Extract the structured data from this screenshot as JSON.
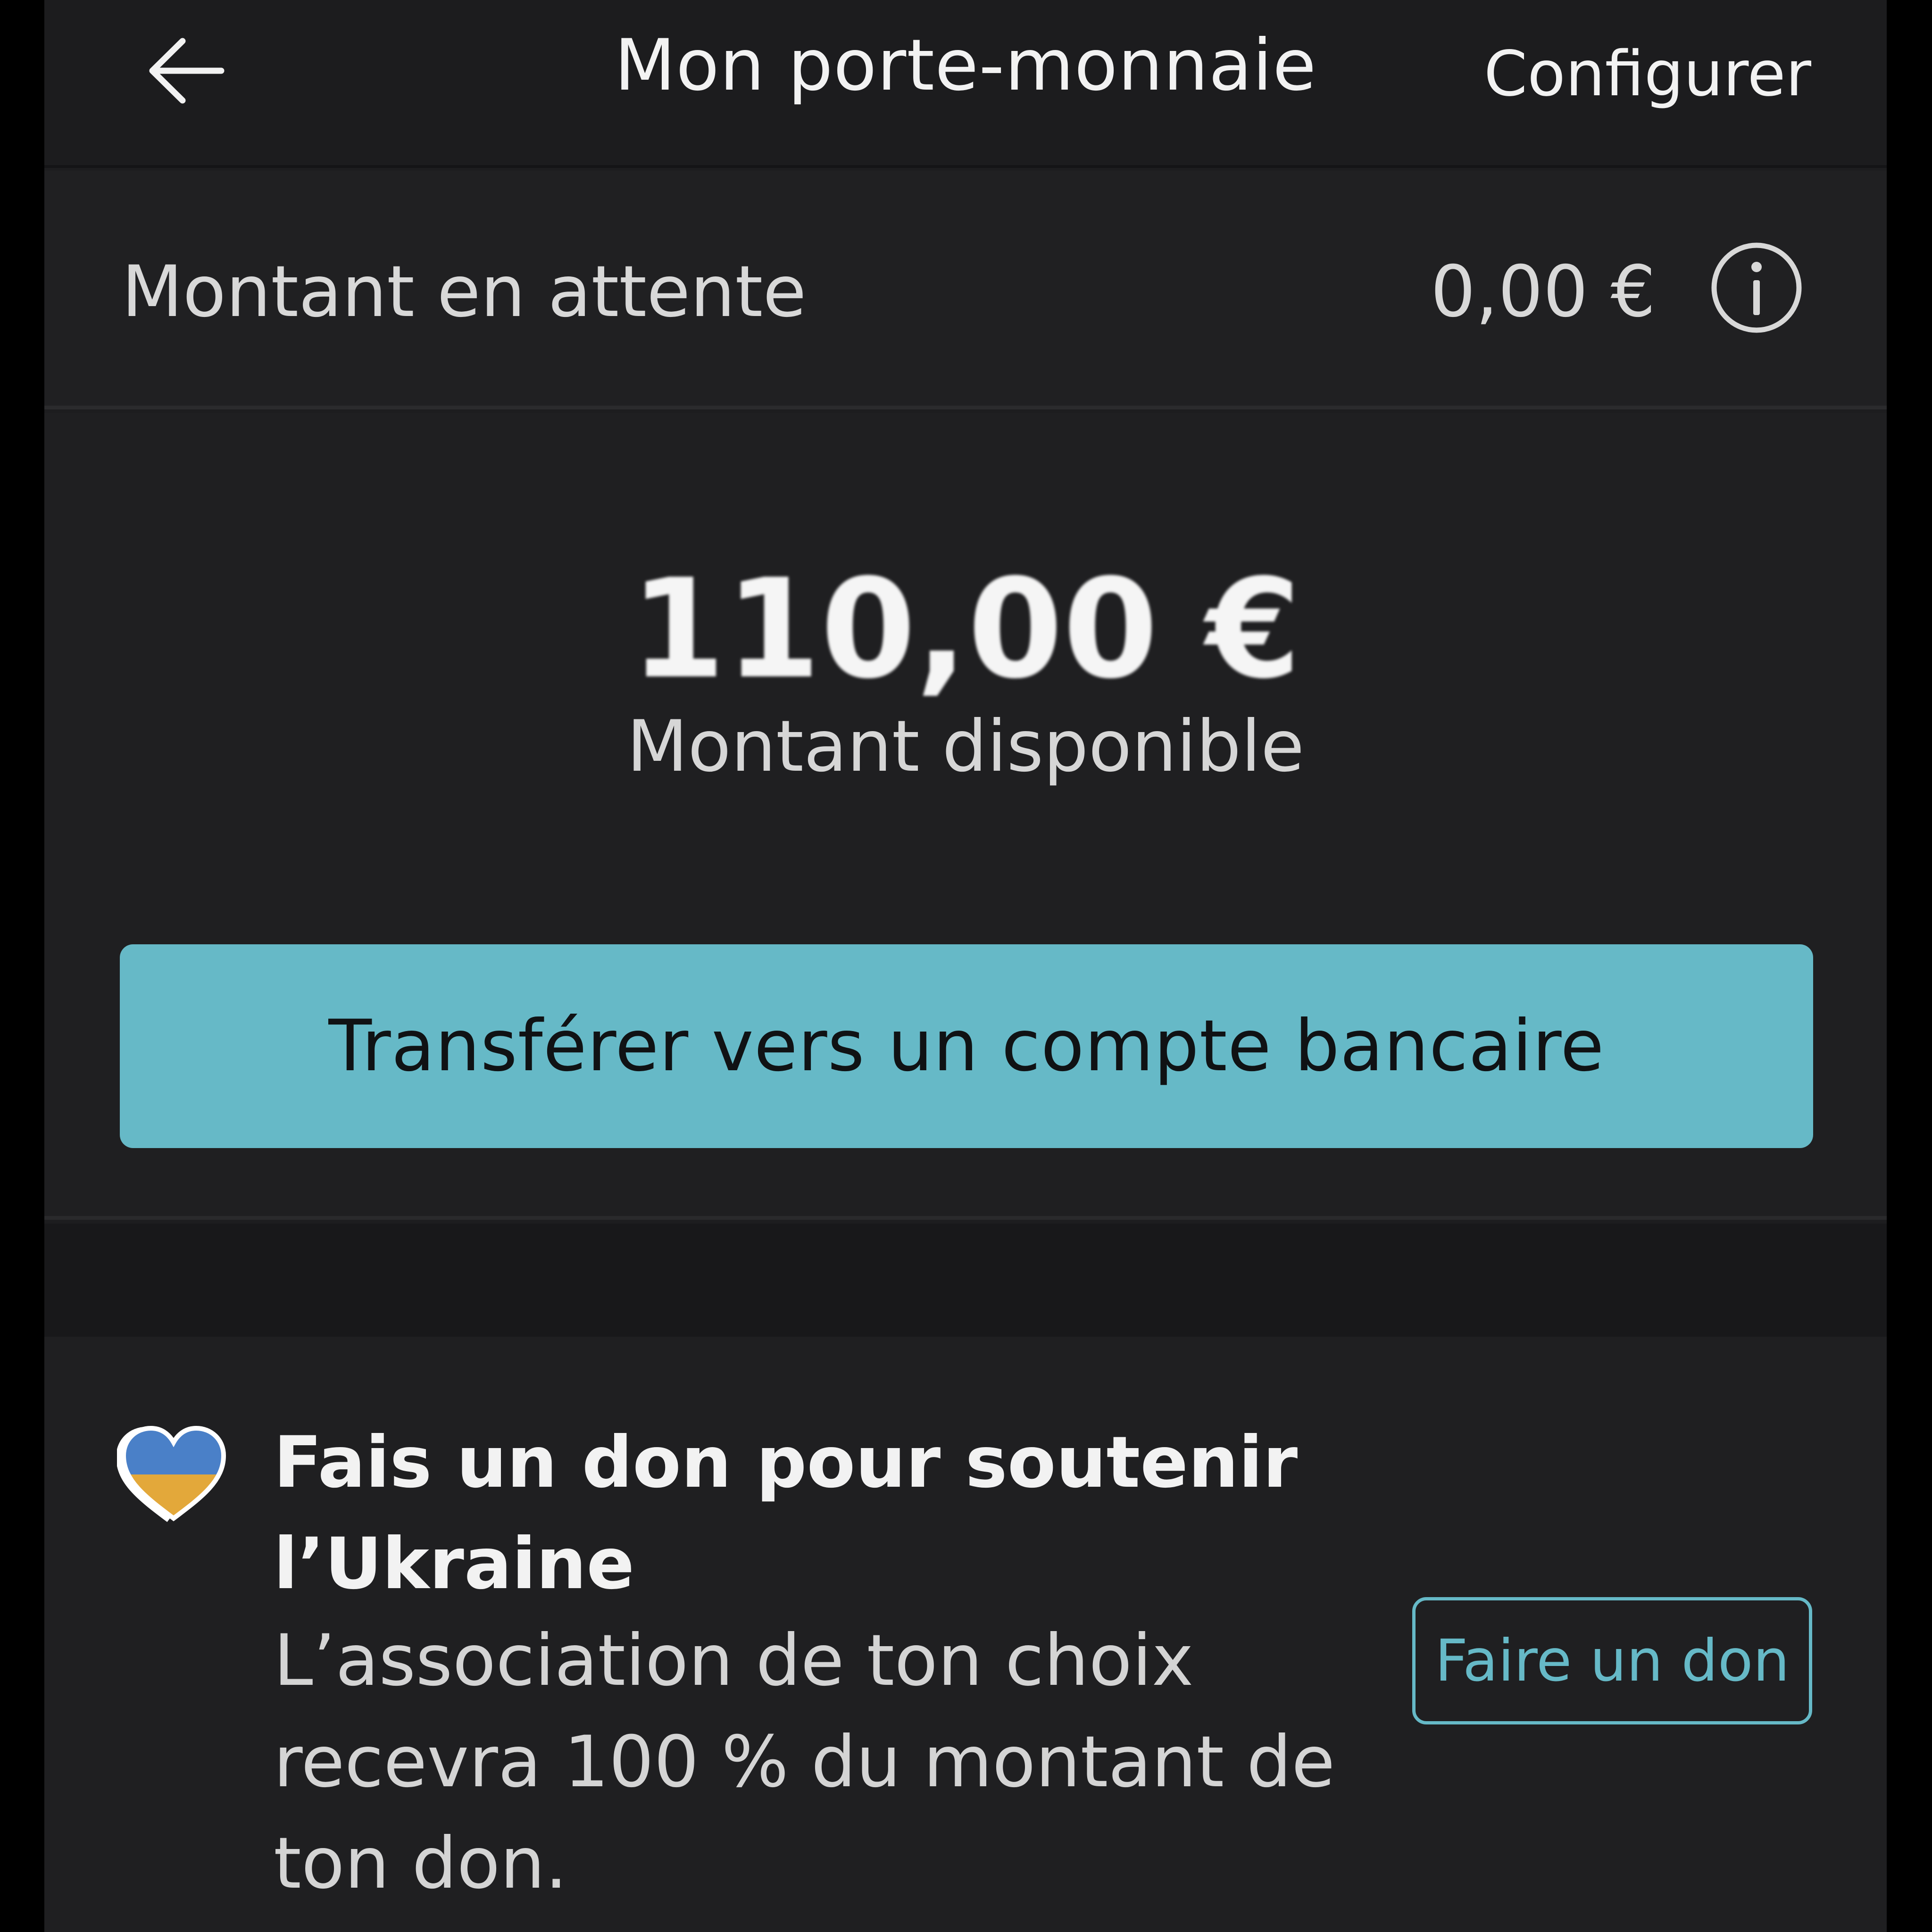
{
  "header": {
    "title": "Mon porte-monnaie",
    "configure_label": "Configurer",
    "back_icon": "arrow-left-icon"
  },
  "pending": {
    "label": "Montant en attente",
    "value": "0,00 €",
    "info_icon": "info-icon"
  },
  "balance": {
    "amount": "110,00 €",
    "label": "Montant disponible",
    "transfer_label": "Transférer vers un compte bancaire"
  },
  "donation": {
    "title": "Fais un don pour soutenir l’Ukraine",
    "description": "L’association de ton choix recevra 100 % du montant de ton don.",
    "button_label": "Faire un don",
    "icon": "ukraine-heart-icon"
  },
  "colors": {
    "accent": "#66b9c7",
    "background": "#1d1d1f",
    "heart_blue": "#4a80c8",
    "heart_yellow": "#e3a83a"
  }
}
